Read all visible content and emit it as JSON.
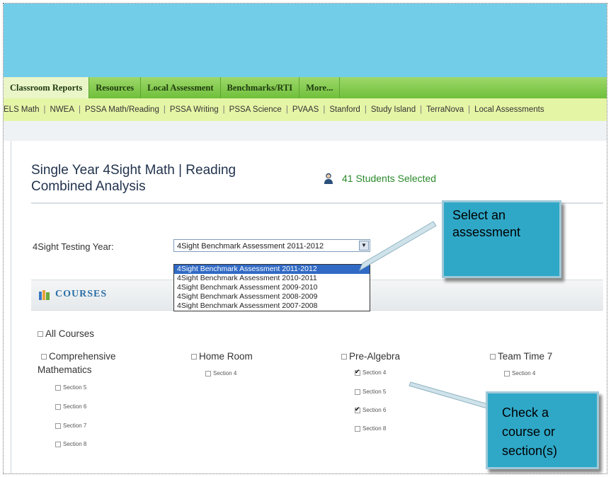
{
  "nav_primary": [
    "Classroom Reports",
    "Resources",
    "Local Assessment",
    "Benchmarks/RTI",
    "More..."
  ],
  "nav_secondary": [
    "ELS Math",
    "NWEA",
    "PSSA Math/Reading",
    "PSSA Writing",
    "PSSA Science",
    "PVAAS",
    "Stanford",
    "Study Island",
    "TerraNova",
    "Local Assessments"
  ],
  "report": {
    "title_line1": "Single Year 4Sight Math | Reading",
    "title_line2": "Combined Analysis",
    "students_selected": "41 Students Selected"
  },
  "testing_year": {
    "label": "4Sight Testing Year:",
    "selected": "4Sight Benchmark Assessment 2011-2012",
    "options": [
      "4Sight Benchmark Assessment 2011-2012",
      "4Sight Benchmark Assessment 2010-2011",
      "4Sight Benchmark Assessment 2009-2010",
      "4Sight Benchmark Assessment 2008-2009",
      "4Sight Benchmark Assessment 2007-2008"
    ]
  },
  "courses": {
    "header": "COURSES",
    "all_courses": "All Courses",
    "list": [
      {
        "name_line1": "Comprehensive",
        "name_line2": "Mathematics",
        "checked": false,
        "sections": [
          {
            "name": "Section 5",
            "checked": false
          },
          {
            "name": "Section 6",
            "checked": false
          },
          {
            "name": "Section 7",
            "checked": false
          },
          {
            "name": "Section 8",
            "checked": false
          }
        ]
      },
      {
        "name_line1": "Home Room",
        "name_line2": "",
        "checked": false,
        "sections": [
          {
            "name": "Section 4",
            "checked": false
          }
        ]
      },
      {
        "name_line1": "Pre-Algebra",
        "name_line2": "",
        "checked": false,
        "sections": [
          {
            "name": "Section 4",
            "checked": true
          },
          {
            "name": "Section 5",
            "checked": false
          },
          {
            "name": "Section 6",
            "checked": true
          },
          {
            "name": "Section 8",
            "checked": false
          }
        ]
      },
      {
        "name_line1": "Team Time 7",
        "name_line2": "",
        "checked": false,
        "sections": [
          {
            "name": "Section 4",
            "checked": false
          }
        ]
      }
    ]
  },
  "callouts": {
    "assessment_line1": "Select an",
    "assessment_line2": "assessment",
    "course_line1": "Check a",
    "course_line2": "course or",
    "course_line3": "section(s)"
  },
  "icons": {
    "person": "person-icon",
    "courses": "books-icon",
    "dropdown_arrow": "chevron-down-icon"
  },
  "colors": {
    "banner": "#72cde9",
    "nav_primary": "#6fbf3b",
    "nav_secondary": "#e5f5a6",
    "callout": "#2fa8c8",
    "title": "#22334d",
    "students": "#2a8a2a",
    "courses_header": "#2b6fa6"
  }
}
